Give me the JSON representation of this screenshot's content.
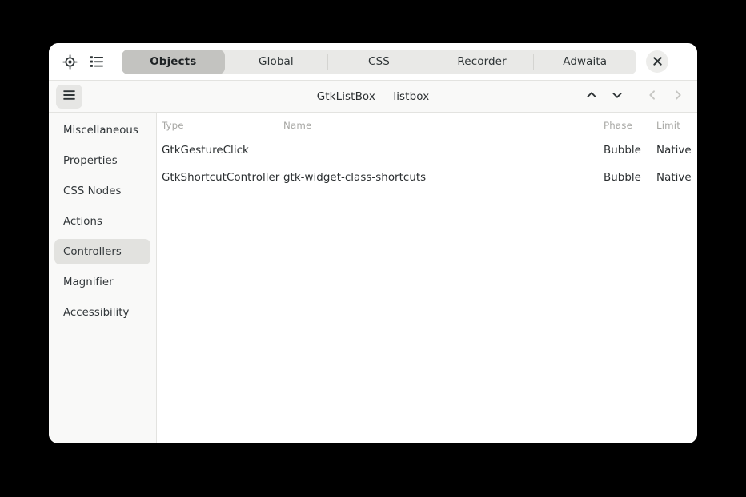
{
  "window": {
    "title": "GtkListBox — listbox"
  },
  "header": {
    "picker_icon": "crosshair-target-icon",
    "list_icon": "bullet-list-icon",
    "close_label": "×",
    "tabs": [
      {
        "label": "Objects",
        "selected": true
      },
      {
        "label": "Global",
        "selected": false
      },
      {
        "label": "CSS",
        "selected": false
      },
      {
        "label": "Recorder",
        "selected": false
      },
      {
        "label": "Adwaita",
        "selected": false
      }
    ]
  },
  "subbar": {
    "menu_icon": "hamburger-menu-icon",
    "title": "GtkListBox — listbox",
    "nav": [
      {
        "name": "move-up-button",
        "icon": "chevron-up-icon",
        "enabled": true
      },
      {
        "name": "move-down-button",
        "icon": "chevron-down-icon",
        "enabled": true
      },
      {
        "name": "back-button",
        "icon": "chevron-left-icon",
        "enabled": false
      },
      {
        "name": "forward-button",
        "icon": "chevron-right-icon",
        "enabled": false
      }
    ]
  },
  "sidebar": {
    "items": [
      {
        "label": "Miscellaneous",
        "selected": false
      },
      {
        "label": "Properties",
        "selected": false
      },
      {
        "label": "CSS Nodes",
        "selected": false
      },
      {
        "label": "Actions",
        "selected": false
      },
      {
        "label": "Controllers",
        "selected": true
      },
      {
        "label": "Magnifier",
        "selected": false
      },
      {
        "label": "Accessibility",
        "selected": false
      }
    ]
  },
  "controllers_table": {
    "columns": [
      "Type",
      "Name",
      "Phase",
      "Limit"
    ],
    "rows": [
      {
        "type": "GtkGestureClick",
        "name": "",
        "phase": "Bubble",
        "limit": "Native"
      },
      {
        "type": "GtkShortcutController",
        "name": "gtk-widget-class-shortcuts",
        "phase": "Bubble",
        "limit": "Native"
      }
    ]
  },
  "colors": {
    "window_bg": "#ffffff",
    "chrome_bg": "#f9f9f8",
    "tab_bg": "#e9e9e7",
    "tab_selected_bg": "#c3c3c0",
    "sidebar_selected_bg": "#e2e2df",
    "text": "#2b2f31",
    "muted_text": "#a7a7a4",
    "border": "#e3e3e0",
    "desktop_bg": "#000000"
  }
}
